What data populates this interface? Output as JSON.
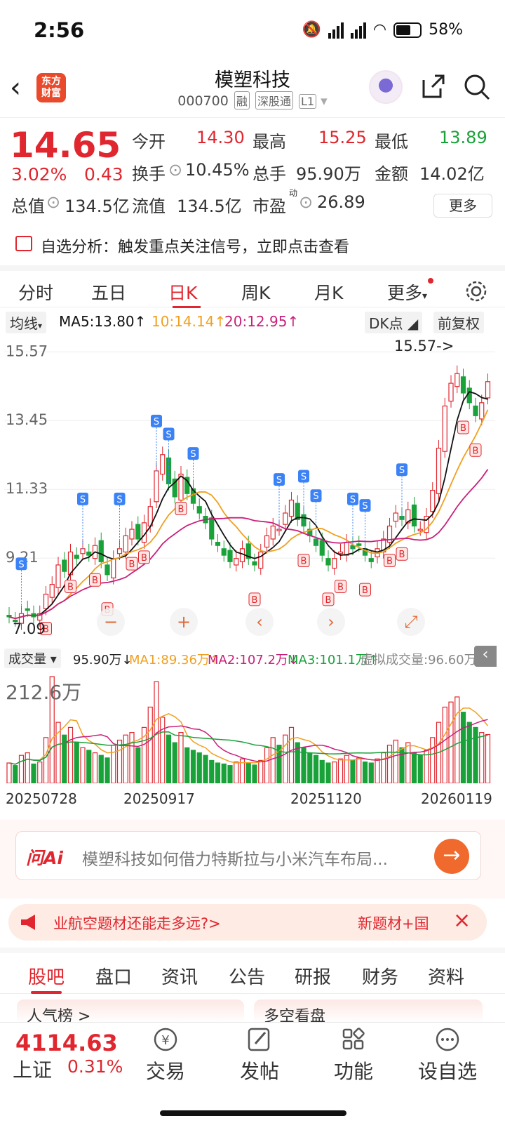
{
  "status": {
    "time": "2:56",
    "battery": "58%",
    "net1": "5G",
    "net2": "5G"
  },
  "header": {
    "title": "模塑科技",
    "code": "000700",
    "tags": [
      "融",
      "深股通",
      "L1"
    ],
    "logo_line1": "东方",
    "logo_line2": "财富"
  },
  "quote": {
    "price": "14.65",
    "pct": "3.02%",
    "chg": "0.43",
    "open_label": "今开",
    "open": "14.30",
    "high_label": "最高",
    "high": "15.25",
    "low_label": "最低",
    "low": "13.89",
    "turnover_label": "换手",
    "turnover": "10.45%",
    "vol_label": "总手",
    "vol": "95.90万",
    "amount_label": "金额",
    "amount": "14.02亿",
    "mktcap_label": "总值",
    "mktcap": "134.5亿",
    "float_label": "流值",
    "float": "134.5亿",
    "pe_label": "市盈",
    "pe_sup": "动",
    "pe": "26.89",
    "more": "更多"
  },
  "analysis": {
    "text": "自选分析：触发重点关注信号，立即点击查看"
  },
  "tabs": {
    "items": [
      "分时",
      "五日",
      "日K",
      "周K",
      "月K",
      "更多"
    ],
    "active": "日K"
  },
  "ma": {
    "selector": "均线",
    "ma5": "MA5:13.80",
    "ma10": "10:14.14",
    "ma20": "20:12.95",
    "dk": "DK点",
    "adj": "前复权",
    "colors": {
      "ma5": "#111111",
      "ma10": "#f0a020",
      "ma20": "#c8207a"
    }
  },
  "chart_data": {
    "type": "candlestick",
    "y_ticks": [
      "15.57",
      "13.45",
      "11.33",
      "9.21"
    ],
    "ylim": [
      6.9,
      15.9
    ],
    "high_marker": "15.57->",
    "low_marker": "7.09",
    "x_labels": [
      "20250728",
      "20250917",
      "20251120",
      "20260119"
    ],
    "closes": [
      7.4,
      7.3,
      7.5,
      7.6,
      7.4,
      7.5,
      8.1,
      8.4,
      9.0,
      8.8,
      9.4,
      9.2,
      9.5,
      9.3,
      9.6,
      9.1,
      8.7,
      9.2,
      9.5,
      9.9,
      10.1,
      9.8,
      10.3,
      10.8,
      11.9,
      12.4,
      11.5,
      11.1,
      11.8,
      11.2,
      10.9,
      10.6,
      10.3,
      9.8,
      9.6,
      9.3,
      9.1,
      9.2,
      9.5,
      9.2,
      9.0,
      9.4,
      9.9,
      10.2,
      10.1,
      10.6,
      11.0,
      10.4,
      10.2,
      9.9,
      9.6,
      9.3,
      9.0,
      9.2,
      9.4,
      9.7,
      9.5,
      9.6,
      9.3,
      9.1,
      9.5,
      9.8,
      10.2,
      10.6,
      10.4,
      10.7,
      10.2,
      10.1,
      10.5,
      11.3,
      12.6,
      13.9,
      14.6,
      14.9,
      14.3,
      14.0,
      13.6,
      14.0,
      14.65
    ],
    "buy_signals": 20,
    "sell_signals": 14,
    "buy_label": "B",
    "sell_label": "S"
  },
  "volume": {
    "selector": "成交量",
    "v": "95.90万",
    "ma1": "MA1:89.36万",
    "ma2": "MA2:107.2万",
    "ma3": "MA3:101.1万",
    "virt": "虚拟成交量:96.60万",
    "ymax": "212.6万",
    "values": [
      40,
      35,
      55,
      60,
      38,
      42,
      90,
      210,
      120,
      95,
      110,
      80,
      70,
      65,
      60,
      55,
      50,
      75,
      85,
      95,
      100,
      70,
      110,
      150,
      200,
      130,
      95,
      80,
      100,
      70,
      65,
      60,
      55,
      45,
      40,
      38,
      35,
      42,
      48,
      40,
      36,
      45,
      70,
      90,
      75,
      95,
      110,
      80,
      70,
      60,
      55,
      45,
      40,
      42,
      48,
      55,
      45,
      50,
      42,
      40,
      48,
      60,
      75,
      85,
      70,
      80,
      60,
      55,
      65,
      90,
      120,
      150,
      160,
      170,
      140,
      120,
      110,
      100,
      96
    ]
  },
  "ai": {
    "logo": "问Ai",
    "question": "模塑科技如何借力特斯拉与小米汽车布局..."
  },
  "banner": {
    "left": "业航空题材还能走多远?>",
    "right": "新题材+国"
  },
  "subtabs": {
    "items": [
      "股吧",
      "盘口",
      "资讯",
      "公告",
      "研报",
      "财务",
      "资料"
    ],
    "active": "股吧"
  },
  "cards": {
    "left": "人气榜 >",
    "right": "多空看盘"
  },
  "bottom": {
    "index_value": "4114.63",
    "index_name": "上证",
    "index_pct": "0.31%",
    "nav": [
      "交易",
      "发帖",
      "功能",
      "设自选"
    ]
  }
}
